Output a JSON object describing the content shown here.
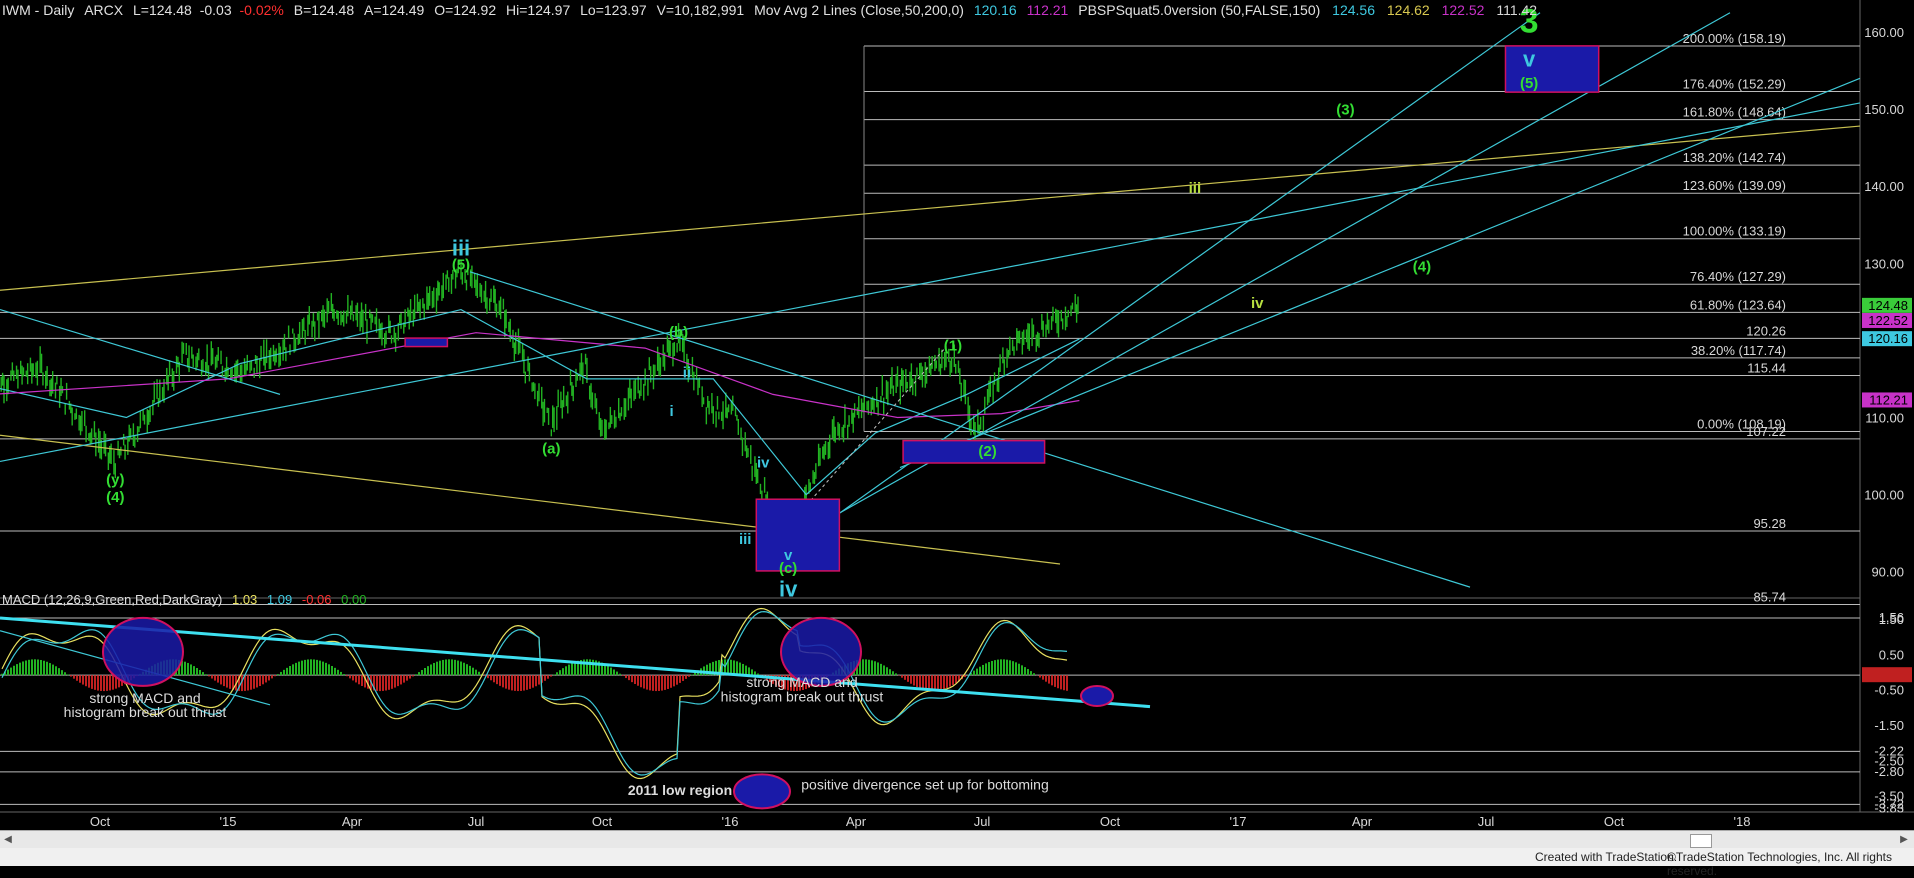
{
  "header": {
    "symbol": "IWM - Daily",
    "exchange": "ARCX",
    "last": "L=124.48",
    "chg": "-0.03",
    "chg_pct": "-0.02%",
    "bid": "B=124.48",
    "ask": "A=124.49",
    "open": "O=124.92",
    "high": "Hi=124.97",
    "low": "Lo=123.97",
    "volume": "V=10,182,991",
    "ma_study": "Mov Avg 2 Lines (Close,50,200,0)",
    "ma_v1": "120.16",
    "ma_v2": "112.21",
    "custom_study": "PBSPSquat5.0version (50,FALSE,150)",
    "cs_v1": "124.56",
    "cs_v2": "124.62",
    "cs_v3": "122.52",
    "cs_v4": "111.42"
  },
  "macd_header": {
    "label": "MACD (12,26,9,Green,Red,DarkGray)",
    "v1": "1.03",
    "v2": "1.09",
    "v3": "-0.06",
    "v4": "0.00"
  },
  "colors": {
    "background": "#000000",
    "bars": "#22b322",
    "cyan_line": "#3ec8d6",
    "yellow_line": "#c8c050",
    "magenta_ma": "#c832c8",
    "wave_green": "#33dd33",
    "wave_cyan": "#3ec8e0",
    "box_fill": "#1a1aa8",
    "box_border": "#d01060",
    "macd_hist_pos": "#22b322",
    "macd_hist_neg": "#c02020",
    "macd_line": "#e8e060",
    "macd_signal": "#3ec8d6"
  },
  "chart_data": {
    "type": "line",
    "title": "IWM - Daily",
    "price_axis": {
      "range": [
        84,
        162
      ],
      "ticks": [
        "160.00",
        "150.00",
        "140.00",
        "130.00",
        "120.00",
        "110.00",
        "100.00",
        "90.00"
      ]
    },
    "time_axis": [
      "Oct",
      "'15",
      "Apr",
      "Jul",
      "Oct",
      "'16",
      "Apr",
      "Jul",
      "Oct",
      "'17",
      "Apr",
      "Jul",
      "Oct",
      "'18"
    ],
    "horizontal_levels": [
      {
        "value": 158.19,
        "label": "200.00% (158.19)"
      },
      {
        "value": 152.29,
        "label": "176.40% (152.29)"
      },
      {
        "value": 148.64,
        "label": "161.80% (148.64)"
      },
      {
        "value": 142.74,
        "label": "138.20% (142.74)"
      },
      {
        "value": 139.09,
        "label": "123.60% (139.09)"
      },
      {
        "value": 133.19,
        "label": "100.00% (133.19)"
      },
      {
        "value": 127.29,
        "label": "76.40% (127.29)"
      },
      {
        "value": 123.64,
        "label": "61.80% (123.64)"
      },
      {
        "value": 120.26,
        "label": "120.26"
      },
      {
        "value": 117.74,
        "label": "38.20% (117.74)"
      },
      {
        "value": 115.44,
        "label": "115.44"
      },
      {
        "value": 108.19,
        "label": "0.00% (108.19)"
      },
      {
        "value": 107.22,
        "label": "107.22"
      },
      {
        "value": 95.28,
        "label": "95.28"
      },
      {
        "value": 85.74,
        "label": "85.74"
      }
    ],
    "price_tags": [
      {
        "value": 124.48,
        "label": "124.48",
        "color": "#3acc3a"
      },
      {
        "value": 122.52,
        "label": "122.52",
        "color": "#c832c8"
      },
      {
        "value": 120.16,
        "label": "120.16",
        "color": "#3ec8e0"
      },
      {
        "value": 112.21,
        "label": "112.21",
        "color": "#c832c8"
      }
    ],
    "wave_labels": [
      {
        "text": "3",
        "color": "green",
        "x": "2017-08-01",
        "y": 161.5,
        "size": "large"
      },
      {
        "text": "v",
        "color": "cyan",
        "x": "2017-08-01",
        "y": 156.5,
        "size": "medium"
      },
      {
        "text": "(5)",
        "color": "green",
        "x": "2017-08-01",
        "y": 153.4
      },
      {
        "text": "(3)",
        "color": "green",
        "x": "2017-03-20",
        "y": 150.0
      },
      {
        "text": "iii",
        "color": "yellow-green",
        "x": "2016-12-01",
        "y": 139.8
      },
      {
        "text": "(4)",
        "color": "green",
        "x": "2017-05-15",
        "y": 129.6
      },
      {
        "text": "iv",
        "color": "yellow-green",
        "x": "2017-01-15",
        "y": 124.9
      },
      {
        "text": "iii",
        "color": "cyan",
        "x": "2015-06-20",
        "y": 132.0,
        "size": "medium"
      },
      {
        "text": "(5)",
        "color": "green",
        "x": "2015-06-20",
        "y": 129.9
      },
      {
        "text": "(b)",
        "color": "green",
        "x": "2015-11-25",
        "y": 121.1
      },
      {
        "text": "(1)",
        "color": "green",
        "x": "2016-06-10",
        "y": 119.4
      },
      {
        "text": "ii",
        "color": "cyan",
        "x": "2015-12-01",
        "y": 115.9
      },
      {
        "text": "i",
        "color": "cyan",
        "x": "2015-11-20",
        "y": 110.9
      },
      {
        "text": "(a)",
        "color": "green",
        "x": "2015-08-25",
        "y": 106.0
      },
      {
        "text": "(2)",
        "color": "green",
        "x": "2016-07-05",
        "y": 105.7
      },
      {
        "text": "(y)",
        "color": "green",
        "x": "2014-10-12",
        "y": 102.0
      },
      {
        "text": "(4)",
        "color": "green",
        "x": "2014-10-12",
        "y": 99.7
      },
      {
        "text": "iv",
        "color": "cyan",
        "x": "2016-01-25",
        "y": 104.2
      },
      {
        "text": "iii",
        "color": "cyan",
        "x": "2016-01-12",
        "y": 94.3
      },
      {
        "text": "v",
        "color": "cyan",
        "x": "2016-02-12",
        "y": 92.2
      },
      {
        "text": "(c)",
        "color": "green",
        "x": "2016-02-12",
        "y": 90.5
      },
      {
        "text": "iv",
        "color": "cyan",
        "x": "2016-02-12",
        "y": 87.8,
        "size": "medium"
      }
    ],
    "macd_axis": {
      "ticks": [
        "1.56",
        "1.50",
        "0.50",
        "-0.06",
        "-0.50",
        "-1.50",
        "-2.22",
        "-2.50",
        "-2.80",
        "-3.50",
        "-3.72",
        "-3.83"
      ]
    },
    "annotations": [
      {
        "text": "strong MACD and",
        "panel": "macd"
      },
      {
        "text": "histogram break out thrust",
        "panel": "macd"
      },
      {
        "text": "strong MACD  and",
        "panel": "macd"
      },
      {
        "text": "histogram break out thrust",
        "panel": "macd"
      },
      {
        "text": "2011 low region",
        "panel": "macd"
      },
      {
        "text": "positive divergence set up for bottoming",
        "panel": "macd"
      }
    ],
    "grid": false,
    "legend": "none"
  },
  "footer": {
    "created": "Created with TradeStation.",
    "copyright": "©TradeStation Technologies, Inc. All rights reserved."
  }
}
